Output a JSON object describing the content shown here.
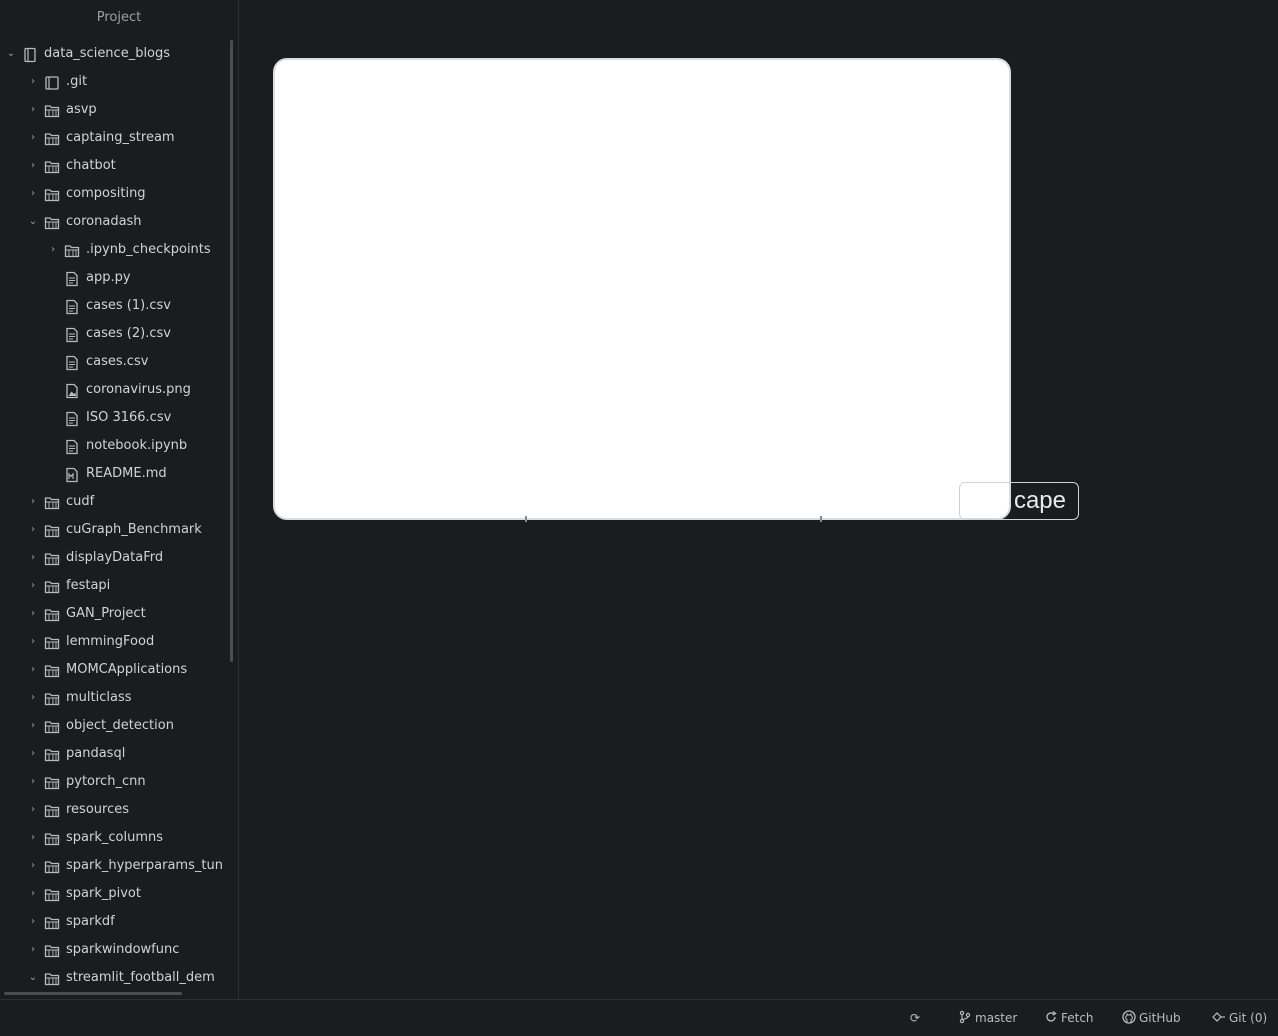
{
  "sidebar": {
    "title": "Project",
    "tree": [
      {
        "label": "data_science_blogs",
        "type": "repo",
        "depth": 0,
        "expanded": true
      },
      {
        "label": ".git",
        "type": "folder-git",
        "depth": 1,
        "expanded": false
      },
      {
        "label": "asvp",
        "type": "folder",
        "depth": 1,
        "expanded": false
      },
      {
        "label": "captaing_stream",
        "type": "folder",
        "depth": 1,
        "expanded": false
      },
      {
        "label": "chatbot",
        "type": "folder",
        "depth": 1,
        "expanded": false
      },
      {
        "label": "compositing",
        "type": "folder",
        "depth": 1,
        "expanded": false
      },
      {
        "label": "coronadash",
        "type": "folder",
        "depth": 1,
        "expanded": true
      },
      {
        "label": ".ipynb_checkpoints",
        "type": "folder",
        "depth": 2,
        "expanded": false
      },
      {
        "label": "app.py",
        "type": "file",
        "depth": 2
      },
      {
        "label": "cases (1).csv",
        "type": "file",
        "depth": 2
      },
      {
        "label": "cases (2).csv",
        "type": "file",
        "depth": 2
      },
      {
        "label": "cases.csv",
        "type": "file",
        "depth": 2
      },
      {
        "label": "coronavirus.png",
        "type": "image",
        "depth": 2
      },
      {
        "label": "ISO 3166.csv",
        "type": "file",
        "depth": 2
      },
      {
        "label": "notebook.ipynb",
        "type": "file",
        "depth": 2
      },
      {
        "label": "README.md",
        "type": "markdown",
        "depth": 2
      },
      {
        "label": "cudf",
        "type": "folder",
        "depth": 1,
        "expanded": false
      },
      {
        "label": "cuGraph_Benchmark",
        "type": "folder",
        "depth": 1,
        "expanded": false
      },
      {
        "label": "displayDataFrd",
        "type": "folder",
        "depth": 1,
        "expanded": false
      },
      {
        "label": "festapi",
        "type": "folder",
        "depth": 1,
        "expanded": false
      },
      {
        "label": "GAN_Project",
        "type": "folder",
        "depth": 1,
        "expanded": false
      },
      {
        "label": "lemmingFood",
        "type": "folder",
        "depth": 1,
        "expanded": false
      },
      {
        "label": "MOMCApplications",
        "type": "folder",
        "depth": 1,
        "expanded": false
      },
      {
        "label": "multiclass",
        "type": "folder",
        "depth": 1,
        "expanded": false
      },
      {
        "label": "object_detection",
        "type": "folder",
        "depth": 1,
        "expanded": false
      },
      {
        "label": "pandasql",
        "type": "folder",
        "depth": 1,
        "expanded": false
      },
      {
        "label": "pytorch_cnn",
        "type": "folder",
        "depth": 1,
        "expanded": false
      },
      {
        "label": "resources",
        "type": "folder",
        "depth": 1,
        "expanded": false
      },
      {
        "label": "spark_columns",
        "type": "folder",
        "depth": 1,
        "expanded": false
      },
      {
        "label": "spark_hyperparams_tun",
        "type": "folder",
        "depth": 1,
        "expanded": false
      },
      {
        "label": "spark_pivot",
        "type": "folder",
        "depth": 1,
        "expanded": false
      },
      {
        "label": "sparkdf",
        "type": "folder",
        "depth": 1,
        "expanded": false
      },
      {
        "label": "sparkwindowfunc",
        "type": "folder",
        "depth": 1,
        "expanded": false
      },
      {
        "label": "streamlit_football_dem",
        "type": "folder",
        "depth": 1,
        "expanded": true
      }
    ]
  },
  "editor": {
    "overlay_text": "cape"
  },
  "statusbar": {
    "sync_glyph": "⟳",
    "branch": "master",
    "fetch": "Fetch",
    "github": "GitHub",
    "git": "Git (0)"
  },
  "colors": {
    "background": "#1b1c1e",
    "text": "#cfd3d9",
    "muted": "#9aa0a8",
    "preview": "#ffffff"
  }
}
